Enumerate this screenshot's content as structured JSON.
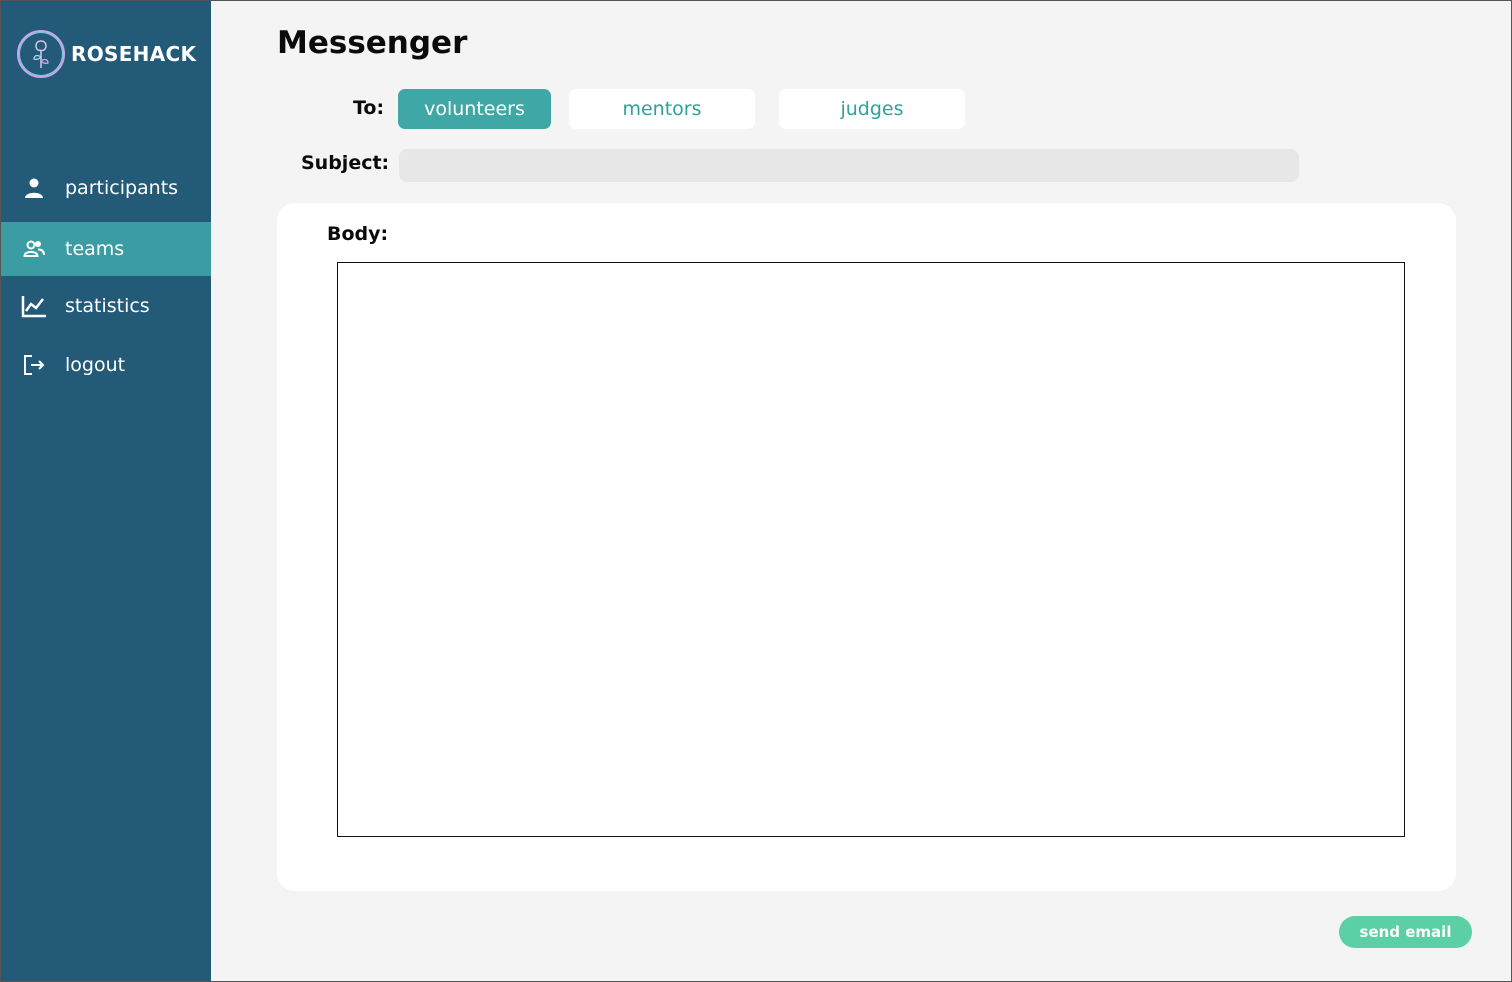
{
  "brand": {
    "name": "ROSEHACK",
    "logo_icon": "rose-logo-icon"
  },
  "sidebar": {
    "items": [
      {
        "label": "participants",
        "icon": "person-icon",
        "active": false
      },
      {
        "label": "teams",
        "icon": "group-icon",
        "active": true
      },
      {
        "label": "statistics",
        "icon": "chart-line-icon",
        "active": false
      },
      {
        "label": "logout",
        "icon": "logout-icon",
        "active": false
      }
    ]
  },
  "main": {
    "title": "Messenger",
    "to_label": "To:",
    "recipients": [
      {
        "label": "volunteers",
        "selected": true
      },
      {
        "label": "mentors",
        "selected": false
      },
      {
        "label": "judges",
        "selected": false
      }
    ],
    "subject_label": "Subject:",
    "subject_value": "",
    "body_label": "Body:",
    "body_value": "",
    "send_label": "send email"
  },
  "colors": {
    "sidebar_bg": "#235a78",
    "active_item": "#3b9da3",
    "selected_recipient": "#3fa7a5",
    "recipient_text": "#2ba39b",
    "send_button": "#5bd0a4"
  }
}
